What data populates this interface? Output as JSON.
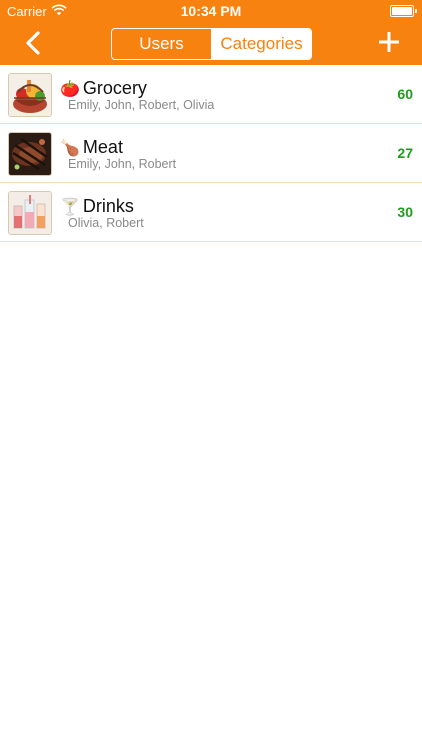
{
  "status_bar": {
    "carrier": "Carrier",
    "time": "10:34 PM"
  },
  "nav": {
    "segments": [
      "Users",
      "Categories"
    ],
    "selected_segment": "Categories",
    "accent_color": "#f8820f"
  },
  "categories": [
    {
      "emoji": "🍅",
      "name": "Grocery",
      "users": "Emily, John, Robert, Olivia",
      "count": "60",
      "image": "grocery-basket"
    },
    {
      "emoji": "🍗",
      "name": "Meat",
      "users": "Emily, John, Robert",
      "count": "27",
      "image": "steak"
    },
    {
      "emoji": "🍸",
      "name": "Drinks",
      "users": "Olivia, Robert",
      "count": "30",
      "image": "drinks-glasses"
    }
  ]
}
